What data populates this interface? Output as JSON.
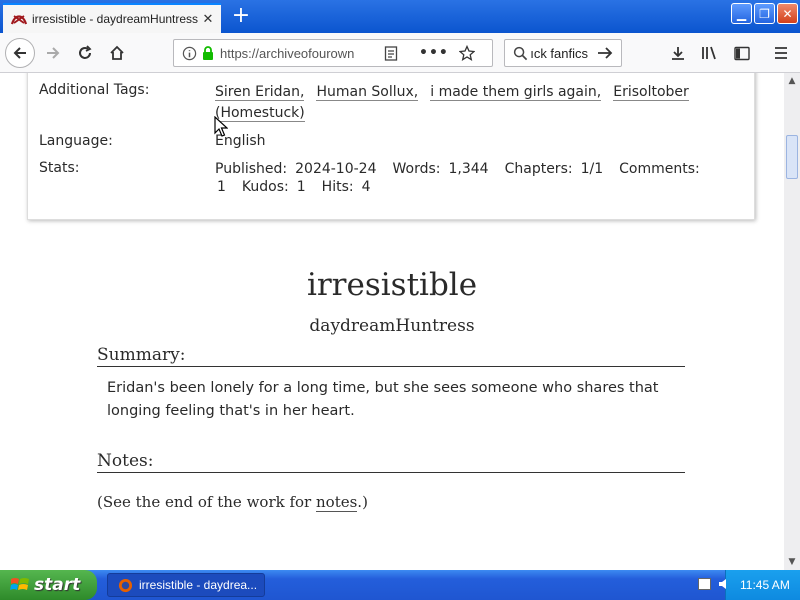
{
  "browser": {
    "tab_title": "irresistible - daydreamHuntress - H",
    "url": "https://archiveofourown",
    "search_value": "ıck fanfics"
  },
  "meta": {
    "additional_tags_label": "Additional Tags:",
    "tags": [
      "Siren Eridan,",
      "Human Sollux,",
      "i made them girls again,",
      "Erisoltober"
    ],
    "tags_line2": "(Homestuck)",
    "language_label": "Language:",
    "language": "English",
    "stats_label": "Stats:",
    "stats": {
      "published_label": "Published:",
      "published": "2024-10-24",
      "words_label": "Words:",
      "words": "1,344",
      "chapters_label": "Chapters:",
      "chapters": "1/1",
      "comments_label": "Comments:",
      "comments": "1",
      "kudos_label": "Kudos:",
      "kudos": "1",
      "hits_label": "Hits:",
      "hits": "4"
    }
  },
  "work": {
    "title": "irresistible",
    "author": "daydreamHuntress",
    "summary_heading": "Summary:",
    "summary_line1": "Eridan's been lonely for a long time, but she sees someone who shares that",
    "summary_line2": "longing feeling that's in her heart.",
    "notes_heading": "Notes:",
    "notes_pre": "(See the end of the work for ",
    "notes_link": "notes",
    "notes_post": ".)"
  },
  "taskbar": {
    "start_label": "start",
    "task_item": "irresistible - daydrea...",
    "clock": "11:45 AM"
  },
  "colors": {
    "taskbar_blue": "#245edb",
    "start_green": "#3a9a35",
    "ao3_text": "#2a2a2a"
  }
}
